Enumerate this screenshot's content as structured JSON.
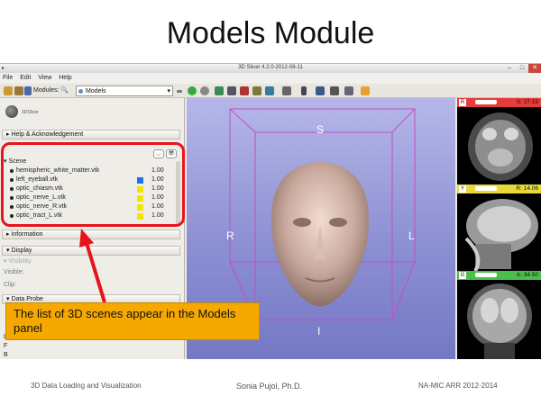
{
  "slide": {
    "title": "Models Module",
    "footer_left": "3D Data Loading and Visualization",
    "footer_center": "Sonia Pujol, Ph.D.",
    "footer_right": "NA-MIC ARR 2012-2014",
    "callout_text": "The list of 3D scenes appear in the Models panel"
  },
  "window": {
    "title": "3D Slicer 4.2.0-2012-08-11"
  },
  "menubar": {
    "items": [
      "File",
      "Edit",
      "View",
      "Help"
    ]
  },
  "toolbar": {
    "modules_label": "Modules:",
    "module_selected": "Models"
  },
  "left_panel": {
    "logo_text": "3DSlicer",
    "help_section": "Help & Acknowledgement",
    "scene_label": "Scene",
    "models": [
      {
        "name": "hemispheric_white_matter.vtk",
        "opacity": "1.00",
        "color": null
      },
      {
        "name": "left_eyeball.vtk",
        "opacity": "1.00",
        "color": "#1a73e8"
      },
      {
        "name": "optic_chiasm.vtk",
        "opacity": "1.00",
        "color": "#f2e600"
      },
      {
        "name": "optic_nerve_L.vtk",
        "opacity": "1.00",
        "color": "#f2e600"
      },
      {
        "name": "optic_nerve_R.vtk",
        "opacity": "1.00",
        "color": "#f2e600"
      },
      {
        "name": "optic_tract_L.vtk",
        "opacity": "1.00",
        "color": "#f2e600"
      }
    ],
    "information_section": "Information",
    "display_section": "Display",
    "visibility_label": "Visibility",
    "visible_label": "Visible:",
    "clip_label": "Clip:",
    "data_probe_section": "Data Probe",
    "probe_letters": [
      "L",
      "F",
      "B"
    ]
  },
  "viewer3d": {
    "top_label": "S",
    "left_label": "R",
    "right_label": "L",
    "bottom_label": "I"
  },
  "slices": [
    {
      "tag": "R",
      "value": "S: 27.19",
      "color": "#e83b3b"
    },
    {
      "tag": "Y",
      "value": "R: 14.06",
      "color": "#e8d83b"
    },
    {
      "tag": "G",
      "value": "A: 34.50",
      "color": "#4bbf4b"
    }
  ],
  "colors": {
    "highlight_red": "#e8141b",
    "callout_orange": "#f5a900"
  }
}
